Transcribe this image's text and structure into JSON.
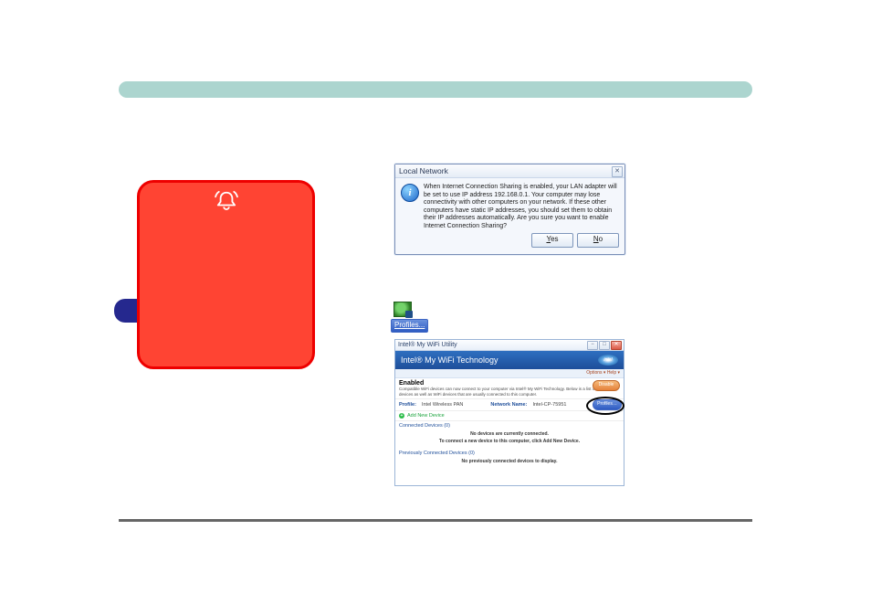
{
  "dialog": {
    "title": "Local Network",
    "icon_glyph": "i",
    "message": "When Internet Connection Sharing is enabled, your LAN adapter will be set to use IP address 192.168.0.1. Your computer may lose connectivity with other computers on your network. If these other computers have static IP addresses, you should set them to obtain their IP addresses automatically. Are you sure you want to enable Internet Connection Sharing?",
    "yes_html": "<u>Y</u>es",
    "no_html": "<u>N</u>o",
    "close_glyph": "✕"
  },
  "profiles_button": "Profiles...",
  "intel": {
    "window_title": "Intel® My WiFi Utility",
    "banner": "Intel® My WiFi Technology",
    "logo_text": "intel",
    "substrip": "Options ▾   Help ▾",
    "enabled_label": "Enabled",
    "enabled_desc": "Compatible WiFi devices can now connect to your computer via Intel® My WiFi Technology. Below is a list of connected devices as well as WiFi devices that are usually connected to this computer.",
    "disable_label": "Disable",
    "profile_label": "Profile:",
    "profile_value": "Intel Wireless PAN",
    "network_label": "Network Name:",
    "network_value": "Intel-CP-75951",
    "profiles_btn": "Profiles…",
    "add_new_device": "Add New Device",
    "connected_label": "Connected Devices (0)",
    "connected_msg1": "No devices are currently connected.",
    "connected_msg2": "To connect a new device to this computer, click Add New Device.",
    "prev_label": "Previously Connected Devices (0)",
    "prev_msg": "No previously connected devices to display.",
    "win_min": "−",
    "win_max": "□",
    "win_close": "✕"
  }
}
